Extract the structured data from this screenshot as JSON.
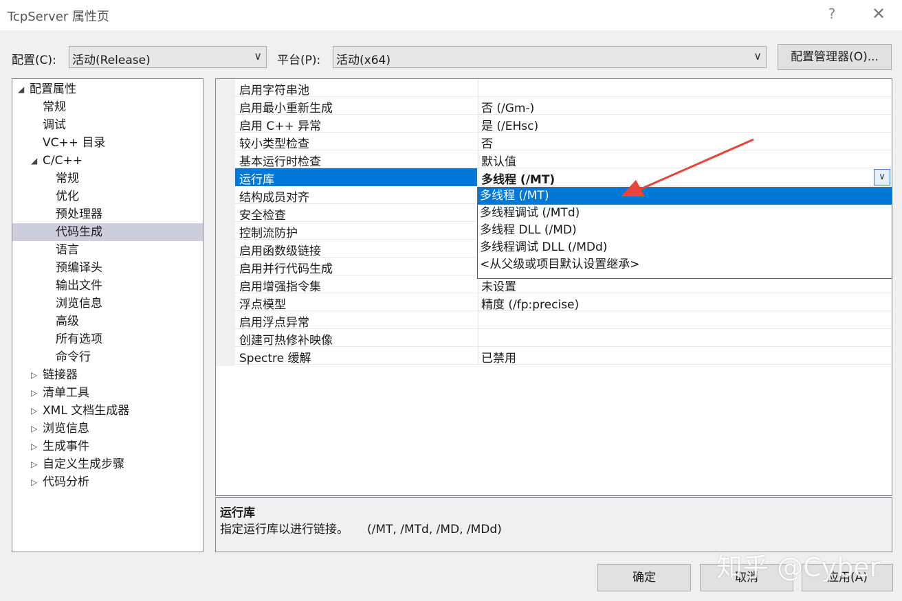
{
  "window": {
    "title": "TcpServer 属性页",
    "help": "?",
    "close": "✕"
  },
  "toolbar": {
    "config_label": "配置(C):",
    "config_value": "活动(Release)",
    "platform_label": "平台(P):",
    "platform_value": "活动(x64)",
    "config_manager_button": "配置管理器(O)..."
  },
  "tree": [
    {
      "label": "配置属性",
      "level": 0,
      "expander": "◢"
    },
    {
      "label": "常规",
      "level": 1
    },
    {
      "label": "调试",
      "level": 1
    },
    {
      "label": "VC++ 目录",
      "level": 1
    },
    {
      "label": "C/C++",
      "level": 1,
      "expander": "◢"
    },
    {
      "label": "常规",
      "level": 2
    },
    {
      "label": "优化",
      "level": 2
    },
    {
      "label": "预处理器",
      "level": 2
    },
    {
      "label": "代码生成",
      "level": 2,
      "selected": true
    },
    {
      "label": "语言",
      "level": 2
    },
    {
      "label": "预编译头",
      "level": 2
    },
    {
      "label": "输出文件",
      "level": 2
    },
    {
      "label": "浏览信息",
      "level": 2
    },
    {
      "label": "高级",
      "level": 2
    },
    {
      "label": "所有选项",
      "level": 2
    },
    {
      "label": "命令行",
      "level": 2
    },
    {
      "label": "链接器",
      "level": 1,
      "expander": "▷"
    },
    {
      "label": "清单工具",
      "level": 1,
      "expander": "▷"
    },
    {
      "label": "XML 文档生成器",
      "level": 1,
      "expander": "▷"
    },
    {
      "label": "浏览信息",
      "level": 1,
      "expander": "▷"
    },
    {
      "label": "生成事件",
      "level": 1,
      "expander": "▷"
    },
    {
      "label": "自定义生成步骤",
      "level": 1,
      "expander": "▷"
    },
    {
      "label": "代码分析",
      "level": 1,
      "expander": "▷"
    }
  ],
  "properties": [
    {
      "name": "启用字符串池",
      "value": ""
    },
    {
      "name": "启用最小重新生成",
      "value": "否 (/Gm-)"
    },
    {
      "name": "启用 C++ 异常",
      "value": "是 (/EHsc)"
    },
    {
      "name": "较小类型检查",
      "value": "否"
    },
    {
      "name": "基本运行时检查",
      "value": "默认值"
    },
    {
      "name": "运行库",
      "value": "多线程 (/MT)",
      "selected": true
    },
    {
      "name": "结构成员对齐",
      "value": ""
    },
    {
      "name": "安全检查",
      "value": ""
    },
    {
      "name": "控制流防护",
      "value": ""
    },
    {
      "name": "启用函数级链接",
      "value": ""
    },
    {
      "name": "启用并行代码生成",
      "value": ""
    },
    {
      "name": "启用增强指令集",
      "value": "未设置"
    },
    {
      "name": "浮点模型",
      "value": "精度 (/fp:precise)"
    },
    {
      "name": "启用浮点异常",
      "value": ""
    },
    {
      "name": "创建可热修补映像",
      "value": ""
    },
    {
      "name": "Spectre 缓解",
      "value": "已禁用"
    }
  ],
  "dropdown": {
    "options": [
      "多线程 (/MT)",
      "多线程调试 (/MTd)",
      "多线程 DLL (/MD)",
      "多线程调试 DLL (/MDd)",
      "<从父级或项目默认设置继承>"
    ],
    "highlighted": 0
  },
  "description": {
    "title": "运行库",
    "text": "指定运行库以进行链接。     (/MT, /MTd, /MD, /MDd)"
  },
  "buttons": {
    "ok": "确定",
    "cancel": "取消",
    "apply": "应用(A)"
  },
  "watermark": "知乎 @Cyber",
  "colors": {
    "selection": "#0078d7",
    "arrow": "#e8443a",
    "tree_selection": "#cdcddc"
  }
}
